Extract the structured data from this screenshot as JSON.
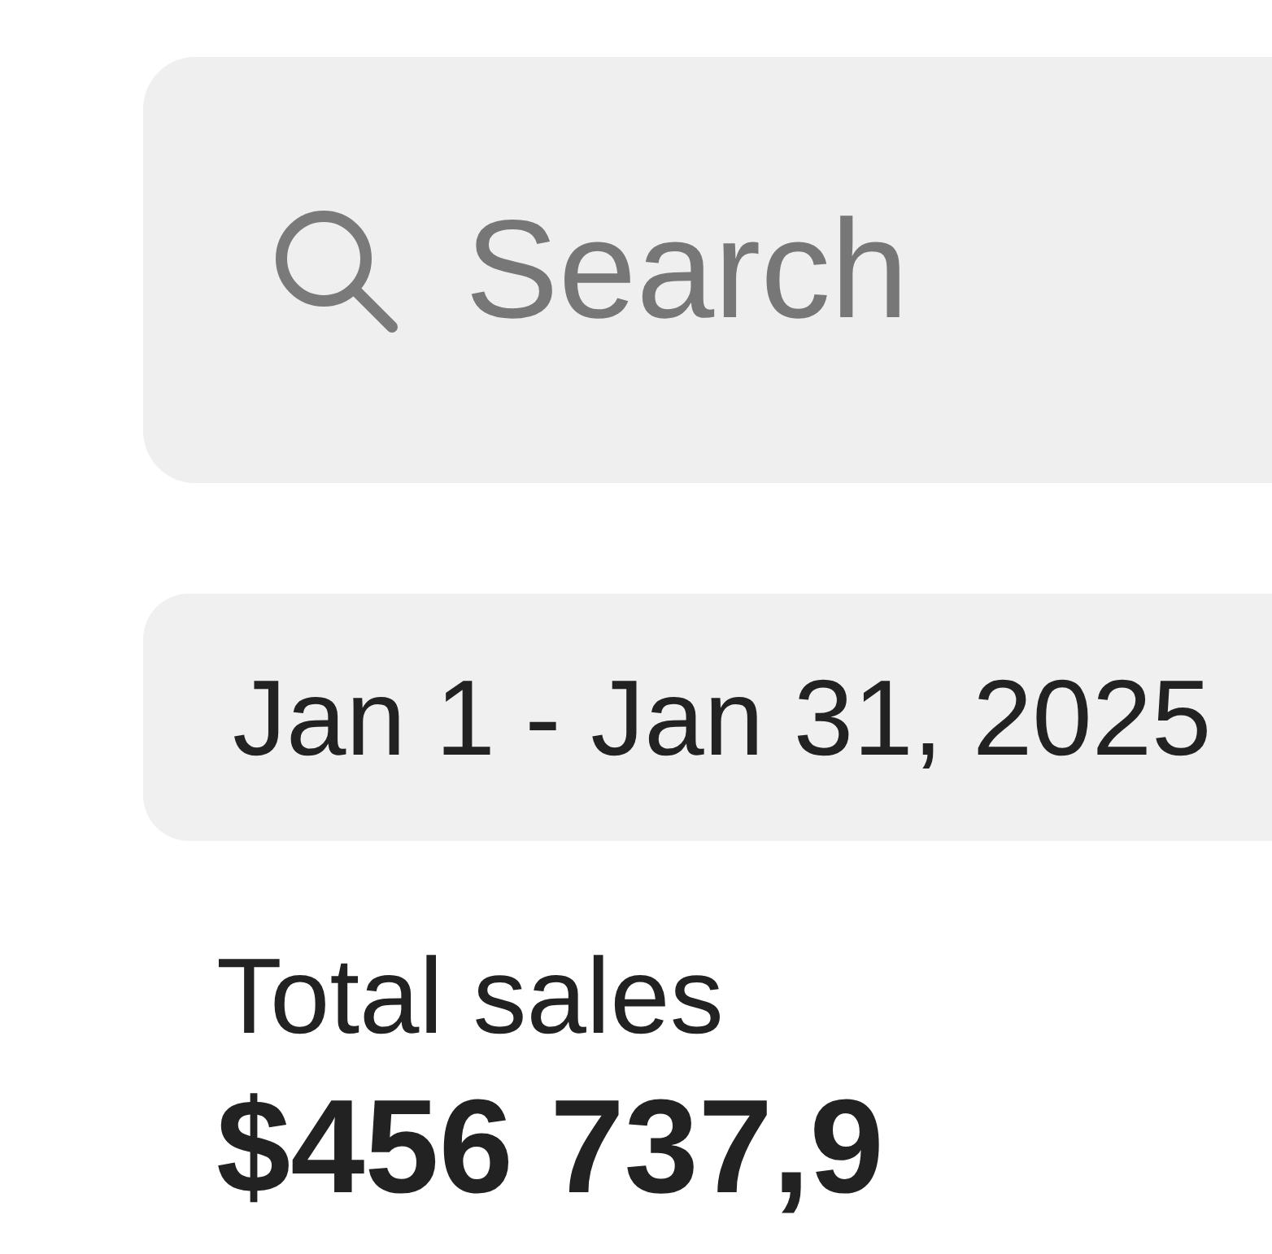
{
  "search": {
    "placeholder": "Search"
  },
  "date_range": {
    "label": "Jan 1 - Jan 31, 2025"
  },
  "metrics": [
    {
      "label": "Total sales",
      "value": "$456 737,9"
    }
  ]
}
